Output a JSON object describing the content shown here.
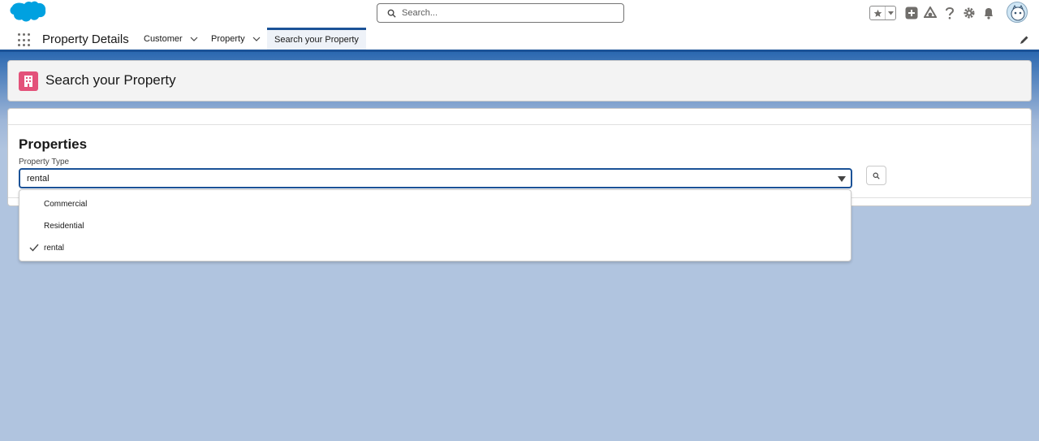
{
  "header": {
    "search_placeholder": "Search...",
    "icons": [
      "salesforce-cloud-logo",
      "search-icon",
      "favorites-star-icon",
      "chevron-down-icon",
      "add-icon",
      "trailhead-icon",
      "help-icon",
      "gear-icon",
      "bell-icon",
      "avatar"
    ]
  },
  "nav": {
    "app_name": "Property Details",
    "tabs": [
      {
        "label": "Customer",
        "has_menu": true
      },
      {
        "label": "Property",
        "has_menu": true
      },
      {
        "label": "Search your Property",
        "active": true
      }
    ]
  },
  "page_header": {
    "title": "Search your Property",
    "icon": "building-icon",
    "icon_color": "#e3527a"
  },
  "card": {
    "title": "Properties",
    "field_label": "Property Type",
    "selected_value": "rental",
    "options": [
      {
        "label": "Commercial",
        "selected": false
      },
      {
        "label": "Residential",
        "selected": false
      },
      {
        "label": "rental",
        "selected": true
      }
    ]
  },
  "colors": {
    "brand_blue": "#1b5297",
    "background": "#b0c4df",
    "logo_blue": "#00a1e0"
  }
}
